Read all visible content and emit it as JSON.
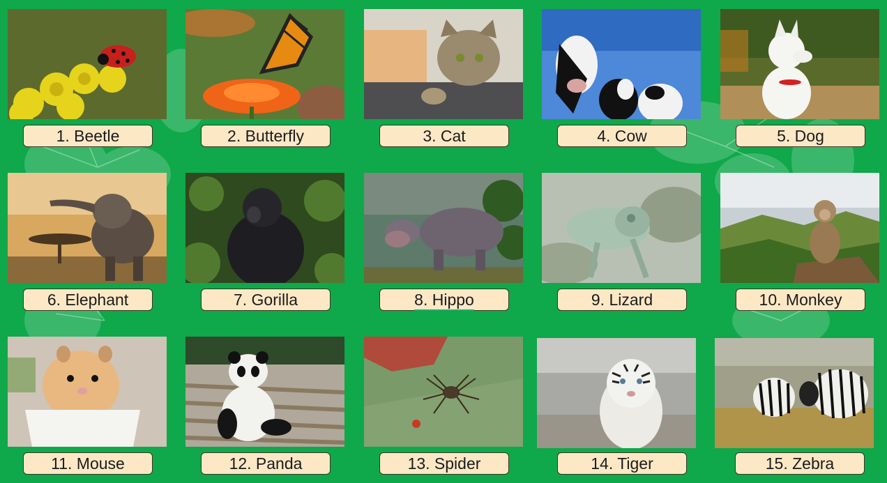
{
  "colors": {
    "background": "#0fa84a",
    "label_fill": "#fde8c6",
    "label_border": "#3b3322"
  },
  "cards": [
    {
      "label": "1. Beetle",
      "image": "ladybug on yellow flowers photo"
    },
    {
      "label": "2. Butterfly",
      "image": "monarch butterfly on orange flower photo"
    },
    {
      "label": "3. Cat",
      "image": "tabby cat on blanket photo"
    },
    {
      "label": "4. Cow",
      "image": "three cows against blue sky photo"
    },
    {
      "label": "5. Dog",
      "image": "white dog with red collar photo"
    },
    {
      "label": "6. Elephant",
      "image": "elephant at sunset with acacia tree photo"
    },
    {
      "label": "7. Gorilla",
      "image": "gorilla in forest photo"
    },
    {
      "label": "8. Hippo",
      "image": "hippo by the water photo"
    },
    {
      "label": "9. Lizard",
      "image": "chameleon on branch photo"
    },
    {
      "label": "10. Monkey",
      "image": "monkey on rock above valley photo"
    },
    {
      "label": "11. Mouse",
      "image": "hamster in white cup photo"
    },
    {
      "label": "12. Panda",
      "image": "giant panda sitting on logs photo"
    },
    {
      "label": "13. Spider",
      "image": "spider on wooden board photo"
    },
    {
      "label": "14. Tiger",
      "image": "white tiger in grass photo"
    },
    {
      "label": "15. Zebra",
      "image": "two zebras in field photo"
    }
  ]
}
